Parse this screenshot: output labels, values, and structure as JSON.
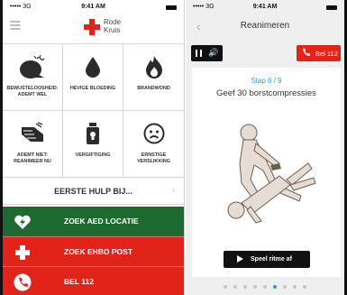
{
  "left": {
    "status": {
      "carrier": "••••• 3G",
      "time": "9:41 AM"
    },
    "logo": {
      "line1": "Rode",
      "line2": "Kruis"
    },
    "grid": [
      {
        "icon": "unconscious-head-icon",
        "label": "BEWUSTELOOSHEID: ADEMT WEL"
      },
      {
        "icon": "blood-drop-icon",
        "label": "HEVIGE BLOEDING"
      },
      {
        "icon": "flame-icon",
        "label": "BRANDWOND"
      },
      {
        "icon": "cpr-hands-icon",
        "label": "ADEMT NIET: REANIMEER NU"
      },
      {
        "icon": "poison-bottle-icon",
        "label": "VERGIFTIGING"
      },
      {
        "icon": "choking-face-icon",
        "label": "ERNSTIGE VERSLIKKING"
      }
    ],
    "first_aid": {
      "label": "EERSTE HULP BIJ...",
      "chevron": "›"
    },
    "actions": {
      "aed": {
        "label": "ZOEK AED LOCATIE",
        "icon": "heart-bolt-icon",
        "color": "#1e6b32"
      },
      "ehbo": {
        "label": "ZOEK EHBO POST",
        "icon": "red-cross-icon",
        "color": "#e2231a"
      },
      "call": {
        "label": "BEL 112",
        "icon": "phone-icon",
        "color": "#e2231a"
      }
    }
  },
  "right": {
    "status": {
      "carrier": "••••• 3G",
      "time": "9:41 AM"
    },
    "title": "Reanimeren",
    "back_glyph": "‹",
    "speaker_glyph": "🔊",
    "call_button": "Bel 112",
    "step": "Stap 6 / 9",
    "instruction": "Geef 30 borstcompressies",
    "play_button": "Speel ritme af",
    "pager": {
      "total": 9,
      "active_index": 5
    }
  },
  "colors": {
    "red": "#e2231a",
    "green": "#1e6b32",
    "blue": "#2e9fd7"
  }
}
